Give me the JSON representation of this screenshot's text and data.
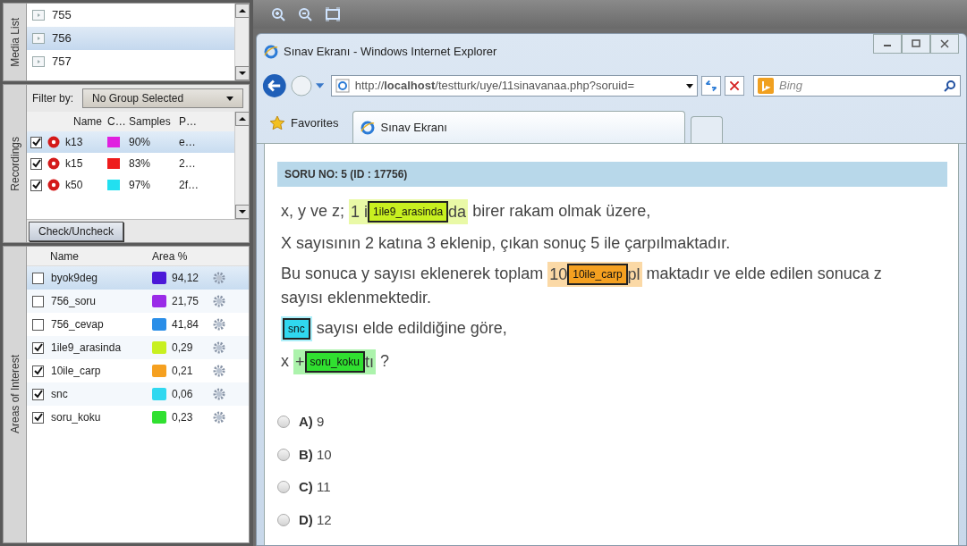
{
  "media_list": {
    "title": "Media List",
    "items": [
      {
        "label": "755",
        "selected": false
      },
      {
        "label": "756",
        "selected": true
      },
      {
        "label": "757",
        "selected": false
      }
    ]
  },
  "recordings": {
    "title": "Recordings",
    "filter_label": "Filter by:",
    "filter_value": "No Group Selected",
    "columns": [
      "Name",
      "C…",
      "Samples",
      "P…"
    ],
    "rows": [
      {
        "name": "k13",
        "color": "#e020e0",
        "samples": "90%",
        "column_4": "e…",
        "checked": true,
        "selected": true
      },
      {
        "name": "k15",
        "color": "#ee1c1c",
        "samples": "83%",
        "column_4": "2…",
        "checked": true,
        "selected": false
      },
      {
        "name": "k50",
        "color": "#22e0f0",
        "samples": "97%",
        "column_4": "2f…",
        "checked": true,
        "selected": false
      }
    ],
    "check_button": "Check/Uncheck"
  },
  "areas_of_interest": {
    "title": "Areas of Interest",
    "columns": [
      "Name",
      "Area %"
    ],
    "rows": [
      {
        "name": "byok9deg",
        "color": "#4b18d8",
        "area": "94,12",
        "checked": false,
        "selected": true
      },
      {
        "name": "756_soru",
        "color": "#9a2be8",
        "area": "21,75",
        "checked": false,
        "selected": false
      },
      {
        "name": "756_cevap",
        "color": "#2a8ee8",
        "area": "41,84",
        "checked": false,
        "selected": false
      },
      {
        "name": "1ile9_arasinda",
        "color": "#c8f020",
        "area": "0,29",
        "checked": true,
        "selected": false
      },
      {
        "name": "10ile_carp",
        "color": "#f5a020",
        "area": "0,21",
        "checked": true,
        "selected": false
      },
      {
        "name": "snc",
        "color": "#30d8f0",
        "area": "0,06",
        "checked": true,
        "selected": false
      },
      {
        "name": "soru_koku",
        "color": "#30e030",
        "area": "0,23",
        "checked": true,
        "selected": false
      }
    ]
  },
  "browser": {
    "title": "Sınav Ekranı - Windows Internet Explorer",
    "address": "http://**localhost**/testturk/uye/11sinavanaa.php?soruid=",
    "search_placeholder": "Bing",
    "favorites": "Favorites",
    "tabs": [
      {
        "label": "Sınav Ekranı",
        "selected": true
      }
    ]
  },
  "question": {
    "header": "SORU NO: 5 (ID : 17756)",
    "lines": [
      [
        {
          "kind": "text",
          "text": "x, y ve z;"
        },
        {
          "kind": "aoi",
          "pre": "1 i",
          "label": "1ile9_arasinda",
          "post": "da",
          "color": "#c8f020"
        },
        {
          "kind": "text",
          "text": "birer rakam olmak üzere,"
        }
      ],
      [
        {
          "kind": "text",
          "text": "X sayısının 2 katına 3 eklenip, çıkan sonuç 5 ile çarpılmaktadır."
        }
      ],
      [
        {
          "kind": "text",
          "text": "Bu sonuca y sayısı eklenerek toplam"
        },
        {
          "kind": "aoi",
          "pre": "10",
          "label": "10ile_carp",
          "post": "pl",
          "color": "#f5a020"
        },
        {
          "kind": "text",
          "text": "maktadır ve elde edilen sonuca z"
        },
        {
          "kind": "text",
          "text": "sayısı eklenmektedir."
        }
      ],
      [
        {
          "kind": "aoi",
          "label": "snc",
          "color": "#30d8f0"
        },
        {
          "kind": "text",
          "text": "sayısı elde edildiğine göre,"
        }
      ],
      [
        {
          "kind": "text",
          "text": "x"
        },
        {
          "kind": "aoi",
          "pre": "+",
          "label": "soru_koku",
          "post": "tı",
          "color": "#30e030"
        },
        {
          "kind": "text",
          "text": "?"
        }
      ]
    ],
    "options": [
      {
        "letter": "A)",
        "value": "9",
        "selected": false
      },
      {
        "letter": "B)",
        "value": "10",
        "selected": false
      },
      {
        "letter": "C)",
        "value": "11",
        "selected": false
      },
      {
        "letter": "D)",
        "value": "12",
        "selected": false
      }
    ]
  }
}
